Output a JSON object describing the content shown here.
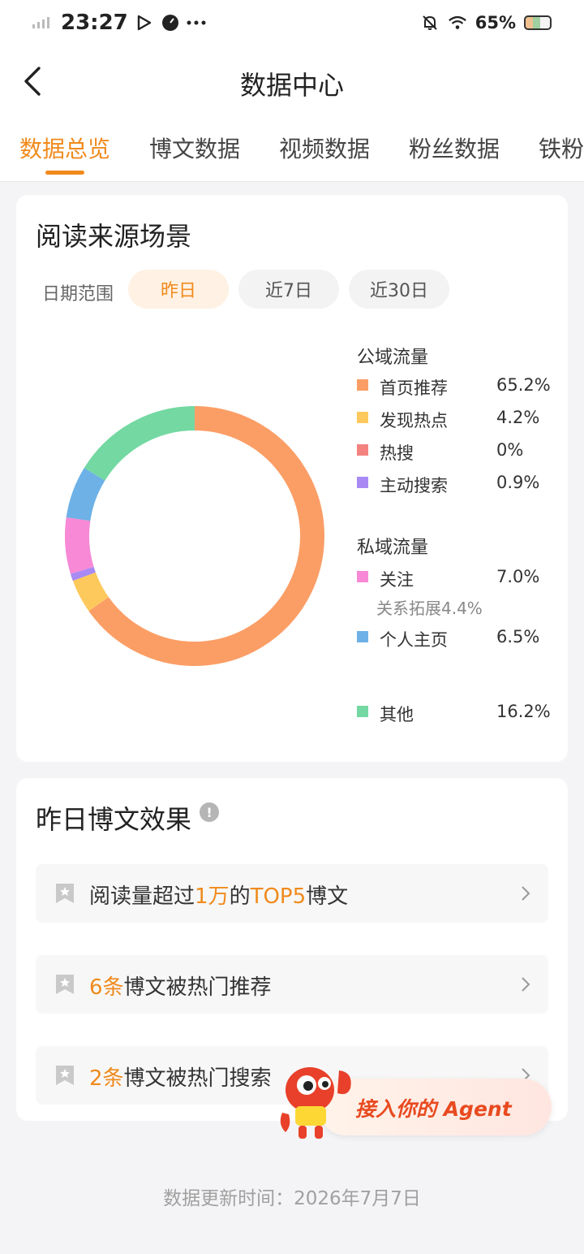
{
  "status_bar": {
    "time": "23:27",
    "battery": "65%",
    "icons": [
      "signal-icon",
      "play-icon",
      "gauge-icon",
      "more-dots-icon",
      "mute-bell-icon",
      "wifi-icon",
      "battery-icon"
    ]
  },
  "header": {
    "title": "数据中心",
    "back_icon": "chevron-left-icon"
  },
  "tabs": [
    {
      "label": "数据总览",
      "active": true
    },
    {
      "label": "博文数据",
      "active": false
    },
    {
      "label": "视频数据",
      "active": false
    },
    {
      "label": "粉丝数据",
      "active": false
    },
    {
      "label": "铁粉",
      "active": false
    }
  ],
  "reading_source": {
    "title": "阅读来源场景",
    "date_range_label": "日期范围",
    "date_options": [
      {
        "label": "昨日",
        "selected": true
      },
      {
        "label": "近7日",
        "selected": false
      },
      {
        "label": "近30日",
        "selected": false
      }
    ],
    "public_group_label": "公域流量",
    "private_group_label": "私域流量",
    "legend": [
      {
        "label": "首页推荐",
        "value": "65.2%",
        "color": "#fb9e66",
        "group": "public"
      },
      {
        "label": "发现热点",
        "value": "4.2%",
        "color": "#fdc95c",
        "group": "public"
      },
      {
        "label": "热搜",
        "value": "0%",
        "color": "#f4827f",
        "group": "public"
      },
      {
        "label": "主动搜索",
        "value": "0.9%",
        "color": "#a98af4",
        "group": "public"
      },
      {
        "label": "关注",
        "value": "7.0%",
        "color": "#f789d6",
        "group": "private"
      },
      {
        "label": "个人主页",
        "value": "6.5%",
        "color": "#6db1e6",
        "group": "private"
      },
      {
        "label": "其他",
        "value": "16.2%",
        "color": "#74d8a2",
        "group": "other"
      }
    ],
    "follow_sub": "关系拓展4.4%"
  },
  "chart_data": {
    "type": "pie",
    "categories": [
      "首页推荐",
      "发现热点",
      "热搜",
      "主动搜索",
      "关注",
      "个人主页",
      "其他"
    ],
    "values": [
      65.2,
      4.2,
      0,
      0.9,
      7.0,
      6.5,
      16.2
    ],
    "colors": [
      "#fb9e66",
      "#fdc95c",
      "#f4827f",
      "#a98af4",
      "#f789d6",
      "#6db1e6",
      "#74d8a2"
    ]
  },
  "post_effect": {
    "title": "昨日博文效果",
    "info_icon": "info-icon",
    "rows": [
      {
        "pre": "阅读量超过",
        "hl1": "1万",
        "mid": "的",
        "hl2": "TOP5",
        "post": "博文"
      },
      {
        "pre": "",
        "hl1": "6条",
        "mid": "博文被热门推荐",
        "hl2": "",
        "post": ""
      },
      {
        "pre": "",
        "hl1": "2条",
        "mid": "博文被热门搜索",
        "hl2": "",
        "post": ""
      }
    ]
  },
  "agent_badge": {
    "text": "接入你的 Agent"
  },
  "footer": {
    "update_time": "数据更新时间：2026年7月7日"
  }
}
